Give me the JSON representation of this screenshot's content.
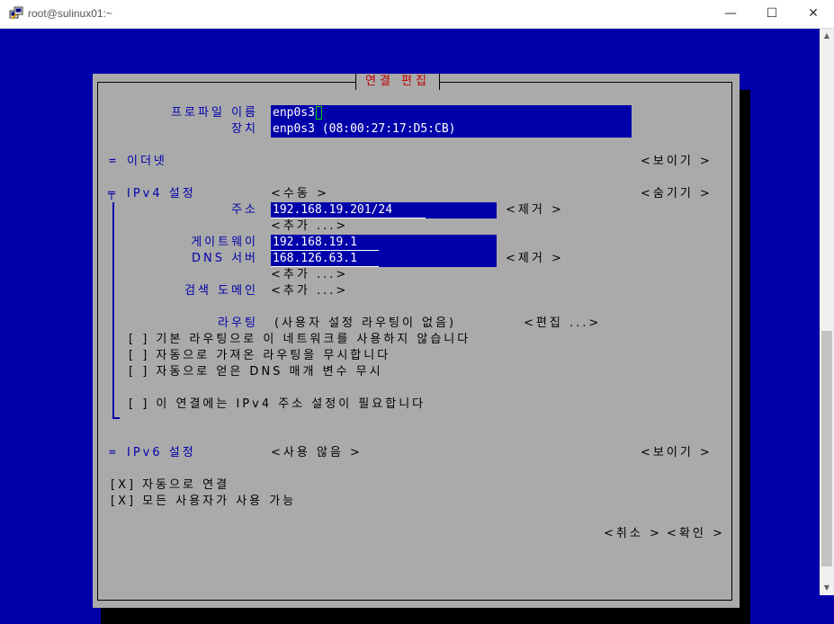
{
  "window": {
    "title": "root@sulinux01:~",
    "min_glyph": "—",
    "max_glyph": "☐",
    "close_glyph": "✕"
  },
  "dialog": {
    "title": "연결 편집",
    "profile_name_label": "프로파일 이름",
    "profile_name_value": "enp0s3",
    "device_label": "장치",
    "device_value": "enp0s3 (08:00:27:17:D5:CB)",
    "ethernet": {
      "marker": "=",
      "label": "이더넷",
      "toggle": "<보이기 >"
    },
    "ipv4": {
      "marker": "╤",
      "label": "IPv4 설정",
      "mode": "<수동 >",
      "toggle": "<숨기기 >",
      "address_label": "주소",
      "address_value": "192.168.19.201/24",
      "address_remove": "<제거 >",
      "address_add": "<추가 ...>",
      "gateway_label": "게이트웨이",
      "gateway_value": "192.168.19.1",
      "dns_label": "DNS 서버",
      "dns_value": "168.126.63.1",
      "dns_remove": "<제거 >",
      "dns_add": "<추가 ...>",
      "search_label": "검색 도메인",
      "search_add": "<추가 ...>",
      "routing_label": "라우팅",
      "routing_value": "(사용자 설정 라우팅이 없음)",
      "routing_edit": "<편집 ...>",
      "opt_never_default": "[ ] 기본 라우팅으로 이 네트워크를 사용하지 않습니다",
      "opt_ignore_routes": "[ ] 자동으로 가져온 라우팅을 무시합니다",
      "opt_ignore_dns": "[ ] 자동으로 얻은 DNS 매개 변수 무시",
      "opt_require_ipv4": "[ ] 이 연결에는 IPv4 주소 설정이 필요합니다"
    },
    "ipv6": {
      "marker": "=",
      "label": "IPv6 설정",
      "mode": "<사용 않음 >",
      "toggle": "<보이기 >"
    },
    "auto_connect": "[X] 자동으로 연결",
    "all_users": "[X] 모든 사용자가 사용 가능",
    "cancel": "<취소 >",
    "ok": "<확인 >"
  },
  "colors": {
    "terminal_bg": "#0000aa",
    "dialog_bg": "#aaaaaa",
    "title_fg": "#c00000",
    "field_bg": "#0000aa",
    "field_fg": "#ffffff",
    "label_fg": "#0000aa",
    "cursor": "#00cc00"
  }
}
